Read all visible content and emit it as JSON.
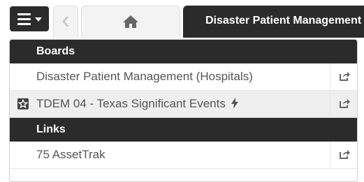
{
  "tabs": {
    "active_label": "Disaster Patient Management"
  },
  "menu": {
    "sections": [
      {
        "title": "Boards",
        "items": [
          {
            "label": "Disaster Patient Management (Hospitals)"
          },
          {
            "label": "TDEM 04 - Texas Significant Events"
          }
        ]
      },
      {
        "title": "Links",
        "items": [
          {
            "label": "75 AssetTrak"
          }
        ]
      }
    ]
  },
  "icons": {
    "menu": "hamburger-icon",
    "back": "chevron-left-icon",
    "home": "home-icon",
    "favorite": "star-icon",
    "open": "share-icon",
    "live": "bolt-icon"
  },
  "colors": {
    "header_bg": "#2b2b2b",
    "header_text": "#ffffff",
    "item_text": "#555555",
    "highlight_bg": "#efefef"
  }
}
